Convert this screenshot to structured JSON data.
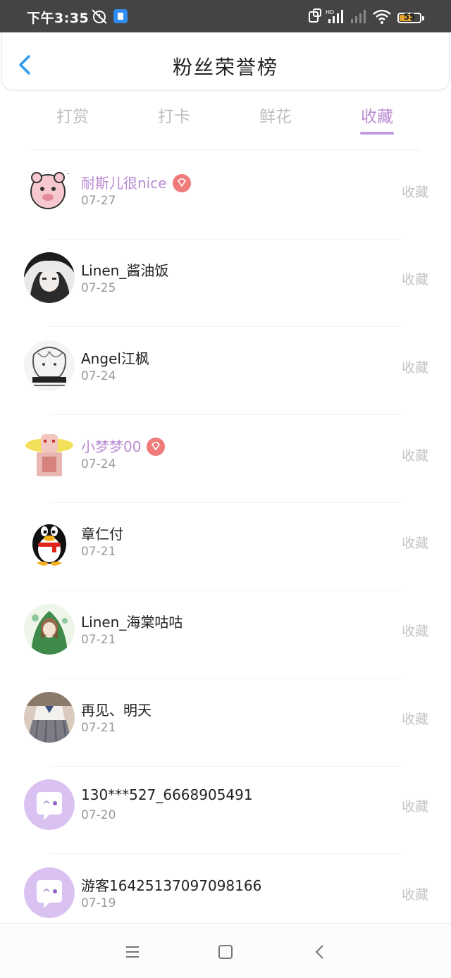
{
  "status_bar": {
    "time": "下午3:35",
    "battery": "55"
  },
  "header": {
    "title": "粉丝荣誉榜"
  },
  "tabs": [
    {
      "label": "打赏"
    },
    {
      "label": "打卡"
    },
    {
      "label": "鲜花"
    },
    {
      "label": "收藏"
    }
  ],
  "active_tab": "收藏",
  "fans": [
    {
      "name": "耐斯儿很nice",
      "date": "07-27",
      "action": "收藏",
      "vip": true,
      "avatar": "pink-sheep-avatar"
    },
    {
      "name": "Linen_酱油饭",
      "date": "07-25",
      "action": "收藏",
      "vip": false,
      "avatar": "anime-boy-avatar"
    },
    {
      "name": "Angel江枫",
      "date": "07-24",
      "action": "收藏",
      "vip": false,
      "avatar": "sketch-avatar"
    },
    {
      "name": "小梦梦00",
      "date": "07-24",
      "action": "收藏",
      "vip": true,
      "avatar": "pixel-character-avatar"
    },
    {
      "name": "章仁付",
      "date": "07-21",
      "action": "收藏",
      "vip": false,
      "avatar": "qq-penguin-avatar"
    },
    {
      "name": "Linen_海棠咕咕",
      "date": "07-21",
      "action": "收藏",
      "vip": false,
      "avatar": "green-girl-avatar"
    },
    {
      "name": "再见、明天",
      "date": "07-21",
      "action": "收藏",
      "vip": false,
      "avatar": "school-uniform-avatar"
    },
    {
      "name": "130***527_6668905491",
      "date": "07-20",
      "action": "收藏",
      "vip": false,
      "avatar": "default-chat-avatar"
    },
    {
      "name": "游客16425137097098166",
      "date": "07-19",
      "action": "收藏",
      "vip": false,
      "avatar": "default-chat-avatar"
    }
  ],
  "colors": {
    "accent": "#b98ad2",
    "status_bar": "#444444",
    "vip_badge": "#f07b7b"
  }
}
